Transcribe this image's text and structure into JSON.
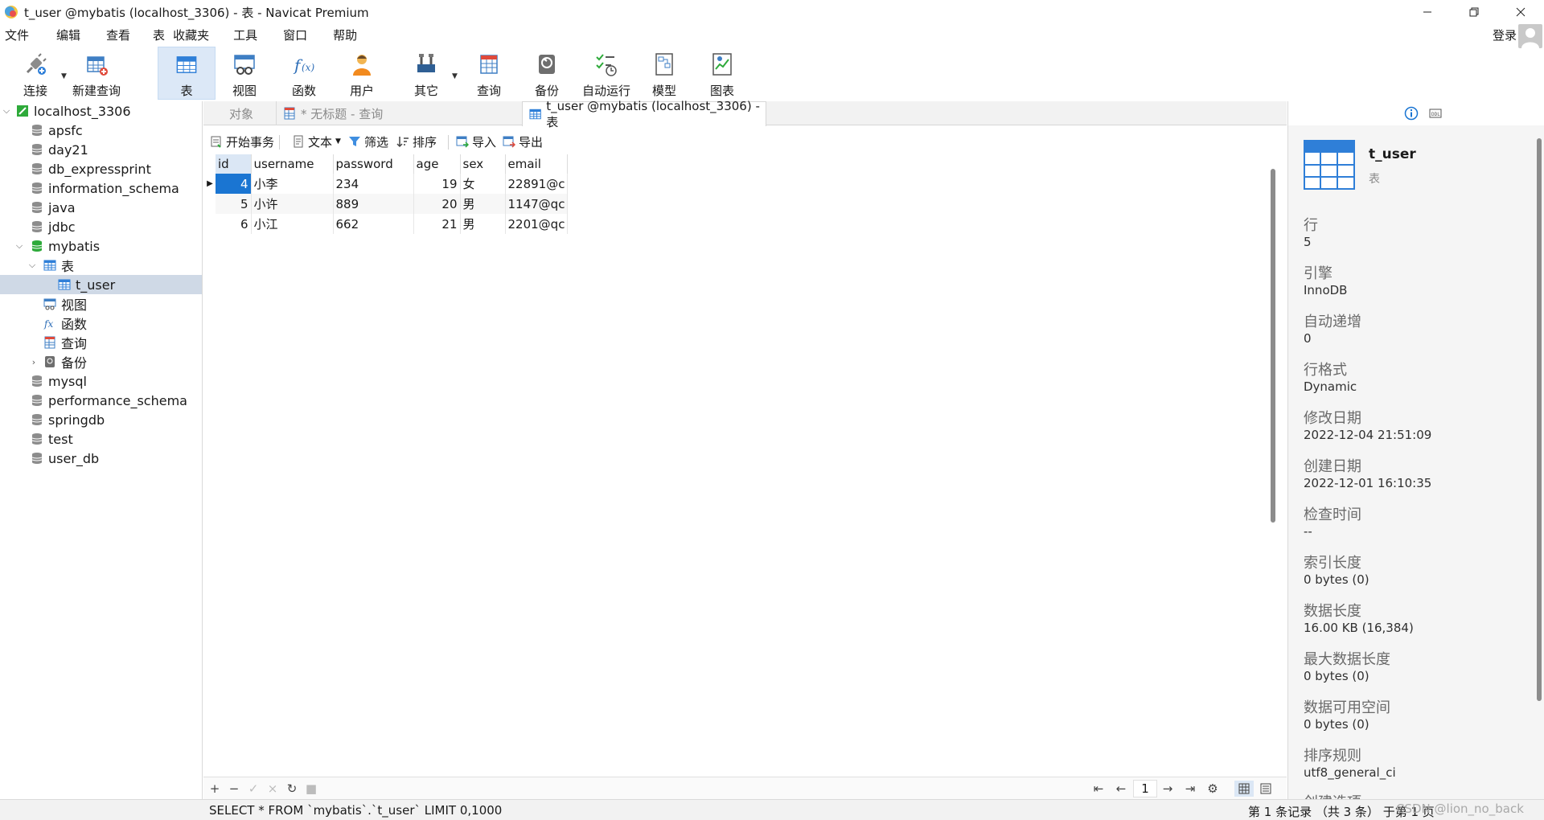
{
  "window": {
    "title": "t_user @mybatis (localhost_3306) - 表 - Navicat Premium",
    "minimize_icon": "minimize-icon",
    "maximize_icon": "restore-icon",
    "close_icon": "close-icon"
  },
  "menu": {
    "items": [
      "文件",
      "编辑",
      "查看",
      "表",
      "收藏夹",
      "工具",
      "窗口",
      "帮助"
    ],
    "login": "登录"
  },
  "toolbar": {
    "items": [
      {
        "label": "连接",
        "icon": "plug-icon"
      },
      {
        "label": "新建查询",
        "icon": "new-query-icon"
      },
      {
        "label": "表",
        "icon": "table-icon"
      },
      {
        "label": "视图",
        "icon": "view-icon"
      },
      {
        "label": "函数",
        "icon": "function-icon"
      },
      {
        "label": "用户",
        "icon": "user-icon"
      },
      {
        "label": "其它",
        "icon": "tools-icon"
      },
      {
        "label": "查询",
        "icon": "query-icon"
      },
      {
        "label": "备份",
        "icon": "backup-icon"
      },
      {
        "label": "自动运行",
        "icon": "automation-icon"
      },
      {
        "label": "模型",
        "icon": "model-icon"
      },
      {
        "label": "图表",
        "icon": "chart-icon"
      }
    ]
  },
  "nav": {
    "connection": "localhost_3306",
    "items": [
      {
        "label": "apsfc"
      },
      {
        "label": "day21"
      },
      {
        "label": "db_expressprint"
      },
      {
        "label": "information_schema"
      },
      {
        "label": "java"
      },
      {
        "label": "jdbc"
      },
      {
        "label": "mybatis"
      },
      {
        "label": "表"
      },
      {
        "label": "t_user"
      },
      {
        "label": "视图"
      },
      {
        "label": "函数"
      },
      {
        "label": "查询"
      },
      {
        "label": "备份"
      },
      {
        "label": "mysql"
      },
      {
        "label": "performance_schema"
      },
      {
        "label": "springdb"
      },
      {
        "label": "test"
      },
      {
        "label": "user_db"
      }
    ]
  },
  "tabs": {
    "objects": "对象",
    "query": "* 无标题 - 查询",
    "table": "t_user @mybatis (localhost_3306) - 表"
  },
  "subbar": {
    "begin_tx": "开始事务",
    "text": "文本",
    "filter": "筛选",
    "sort": "排序",
    "import": "导入",
    "export": "导出"
  },
  "grid": {
    "columns": [
      "id",
      "username",
      "password",
      "age",
      "sex",
      "email"
    ],
    "rows": [
      [
        "4",
        "小李",
        "234",
        "19",
        "女",
        "22891@c"
      ],
      [
        "5",
        "小许",
        "889",
        "20",
        "男",
        "1147@qc"
      ],
      [
        "6",
        "小江",
        "662",
        "21",
        "男",
        "2201@qc"
      ]
    ],
    "page": "1"
  },
  "status": {
    "sql": "SELECT * FROM `mybatis`.`t_user` LIMIT 0,1000",
    "records": "第 1 条记录 （共 3 条） 于第 1 页",
    "watermark": "CSDN @lion_no_back"
  },
  "info": {
    "name": "t_user",
    "type": "表",
    "fields": [
      {
        "label": "行",
        "value": "5"
      },
      {
        "label": "引擎",
        "value": "InnoDB"
      },
      {
        "label": "自动递增",
        "value": "0"
      },
      {
        "label": "行格式",
        "value": "Dynamic"
      },
      {
        "label": "修改日期",
        "value": "2022-12-04 21:51:09"
      },
      {
        "label": "创建日期",
        "value": "2022-12-01 16:10:35"
      },
      {
        "label": "检查时间",
        "value": "--"
      },
      {
        "label": "索引长度",
        "value": "0 bytes (0)"
      },
      {
        "label": "数据长度",
        "value": "16.00 KB (16,384)"
      },
      {
        "label": "最大数据长度",
        "value": "0 bytes (0)"
      },
      {
        "label": "数据可用空间",
        "value": "0 bytes (0)"
      },
      {
        "label": "排序规则",
        "value": "utf8_general_ci"
      },
      {
        "label": "创建选项",
        "value": ""
      }
    ]
  },
  "colors": {
    "accent": "#0078d7",
    "selection": "#cfd9e6",
    "toolbar_active": "#dce8f7",
    "db_green": "#2eaa3a"
  }
}
